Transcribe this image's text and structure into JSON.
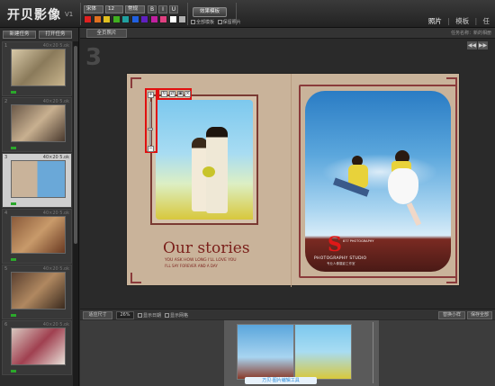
{
  "app": {
    "logo": "开贝影像",
    "version": "V1"
  },
  "toolbar": {
    "font_select": "宋体",
    "size_select": "12",
    "style_select": "常规",
    "bold": "B",
    "italic": "I",
    "underline": "U",
    "apply_label": "效果模板",
    "opt_all_frames": "全部模板",
    "opt_keep_photo": "保留照片",
    "swatch_colors": [
      "#e02020",
      "#e07020",
      "#e0c020",
      "#40b020",
      "#20a0a0",
      "#2060e0",
      "#6020c0",
      "#c020a0",
      "#e04080",
      "#ffffff",
      "#b0b0b0"
    ]
  },
  "top_tabs": {
    "photos": "照片",
    "templates": "模板",
    "more": "任"
  },
  "left_panel": {
    "new_task": "新建任务",
    "open_task": "打开任务",
    "thumbs": [
      {
        "idx": "1",
        "size": "40×20 5.ok"
      },
      {
        "idx": "2",
        "size": "40×20 5.ok"
      },
      {
        "idx": "3",
        "size": "40×20 5.ok"
      },
      {
        "idx": "4",
        "size": "40×20 5.ok"
      },
      {
        "idx": "5",
        "size": "40×20 5.ok"
      },
      {
        "idx": "6",
        "size": "40×20 5.ok"
      }
    ]
  },
  "canvas": {
    "tab_label": "全页照片",
    "right_info": "任务名称：新的相册",
    "page_number": "3",
    "nav_prev": "◀◀",
    "nav_next": "▶▶"
  },
  "spread": {
    "title": "Our stories",
    "subtitle": "YOU ASK HOW LONG I'LL LOVE YOU",
    "subtitle2": "I'LL SAY FOREVER AND A DAY",
    "studio_letter": "S",
    "studio_name": "PHOTOGRAPHY STUDIO",
    "studio_sub": "专业人像摄影工作室",
    "studio_tag": "877  PHOTOGRAPHY"
  },
  "bottom_bar": {
    "fit_btn": "适应尺寸",
    "zoom": "26%",
    "cb_show_date": "显示日期",
    "cb_show_grid": "显示网格",
    "replace_btn": "替换小样",
    "save_btn": "保存全部"
  },
  "film": {
    "caption": "万贝·图片编辑工具"
  }
}
